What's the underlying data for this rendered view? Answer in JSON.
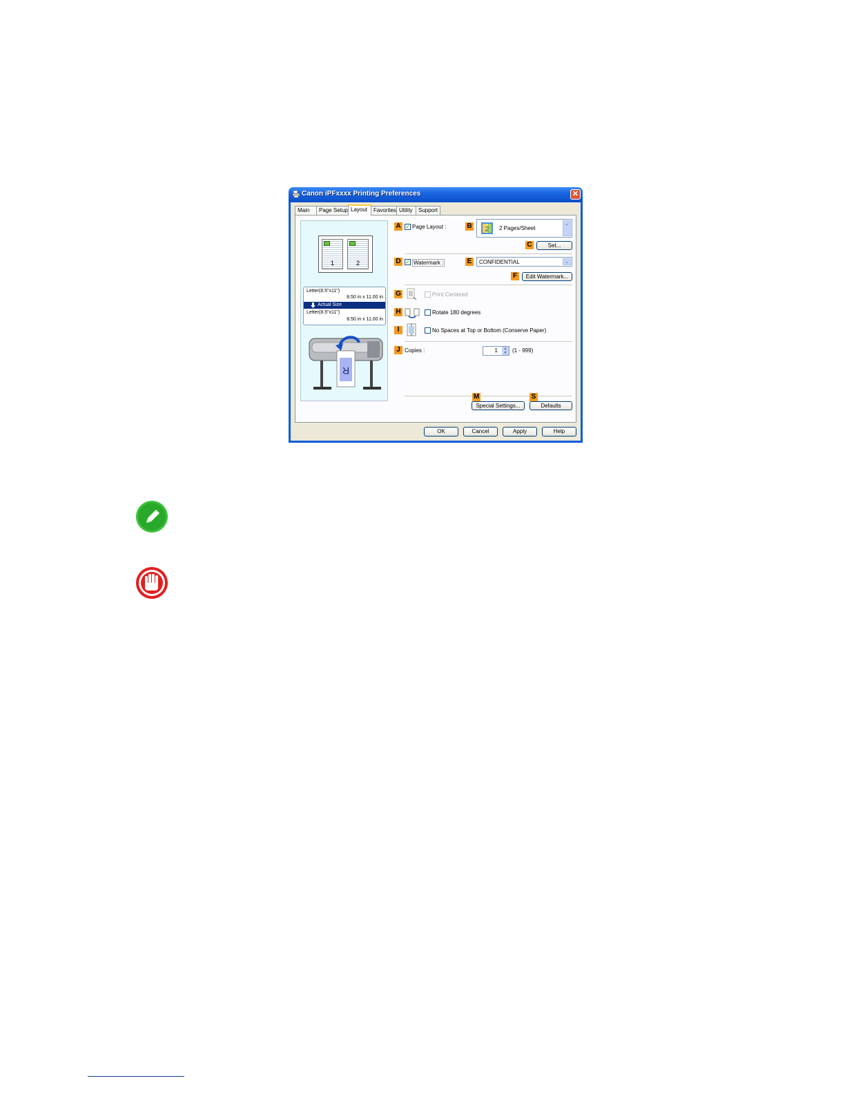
{
  "dialog": {
    "title": "Canon iPFxxxx Printing Preferences",
    "close_label": "✕",
    "tabs": [
      {
        "label": "Main",
        "active": false
      },
      {
        "label": "Page Setup",
        "active": false
      },
      {
        "label": "Layout",
        "active": true
      },
      {
        "label": "Favorites",
        "active": false
      },
      {
        "label": "Utility",
        "active": false
      },
      {
        "label": "Support",
        "active": false
      }
    ],
    "preview": {
      "page_numbers": [
        "1",
        "2"
      ],
      "paper_size_top": "Letter(8.5\"x11\")",
      "paper_dim_top": "8.50 in x 11.00 in",
      "scale_label": "Actual Size",
      "paper_size_bottom": "Letter(8.5\"x11\")",
      "paper_dim_bottom": "8.50 in x 11.00 in",
      "rotated_letter": "R"
    },
    "options": {
      "page_layout": {
        "badge": "A",
        "label": "Page Layout :",
        "checked": true
      },
      "layout_combo": {
        "badge": "B",
        "value": "2 Pages/Sheet",
        "icon_digit": "2"
      },
      "set_button": {
        "badge": "C",
        "label": "Set..."
      },
      "watermark": {
        "badge": "D",
        "label": "Watermark :",
        "checked": true
      },
      "watermark_combo": {
        "badge": "E",
        "value": "CONFIDENTIAL"
      },
      "edit_watermark": {
        "badge": "F",
        "label": "Edit Watermark..."
      },
      "print_centered": {
        "badge": "G",
        "label": "Print Centered",
        "checked": false,
        "disabled": true
      },
      "rotate": {
        "badge": "H",
        "label": "Rotate 180 degrees",
        "checked": false
      },
      "no_spaces": {
        "badge": "I",
        "label": "No Spaces at Top or Bottom (Conserve Paper)",
        "checked": false
      },
      "copies": {
        "badge": "J",
        "label": "Copies :",
        "value": "1",
        "range": "(1 - 999)"
      },
      "special_settings": {
        "badge": "M",
        "label": "Special Settings..."
      },
      "defaults": {
        "badge": "S",
        "label": "Defaults"
      }
    },
    "footer_buttons": {
      "ok": "OK",
      "cancel": "Cancel",
      "apply": "Apply",
      "help": "Help"
    }
  },
  "colors": {
    "title_bar": "#0a5cd8",
    "badge": "#f39a1f",
    "note_icon": "#3cc23c",
    "important_icon": "#e02020",
    "footer_rule": "#1a3a9a"
  },
  "icons": [
    "printer-icon",
    "note-pencil-icon",
    "important-hand-icon"
  ]
}
